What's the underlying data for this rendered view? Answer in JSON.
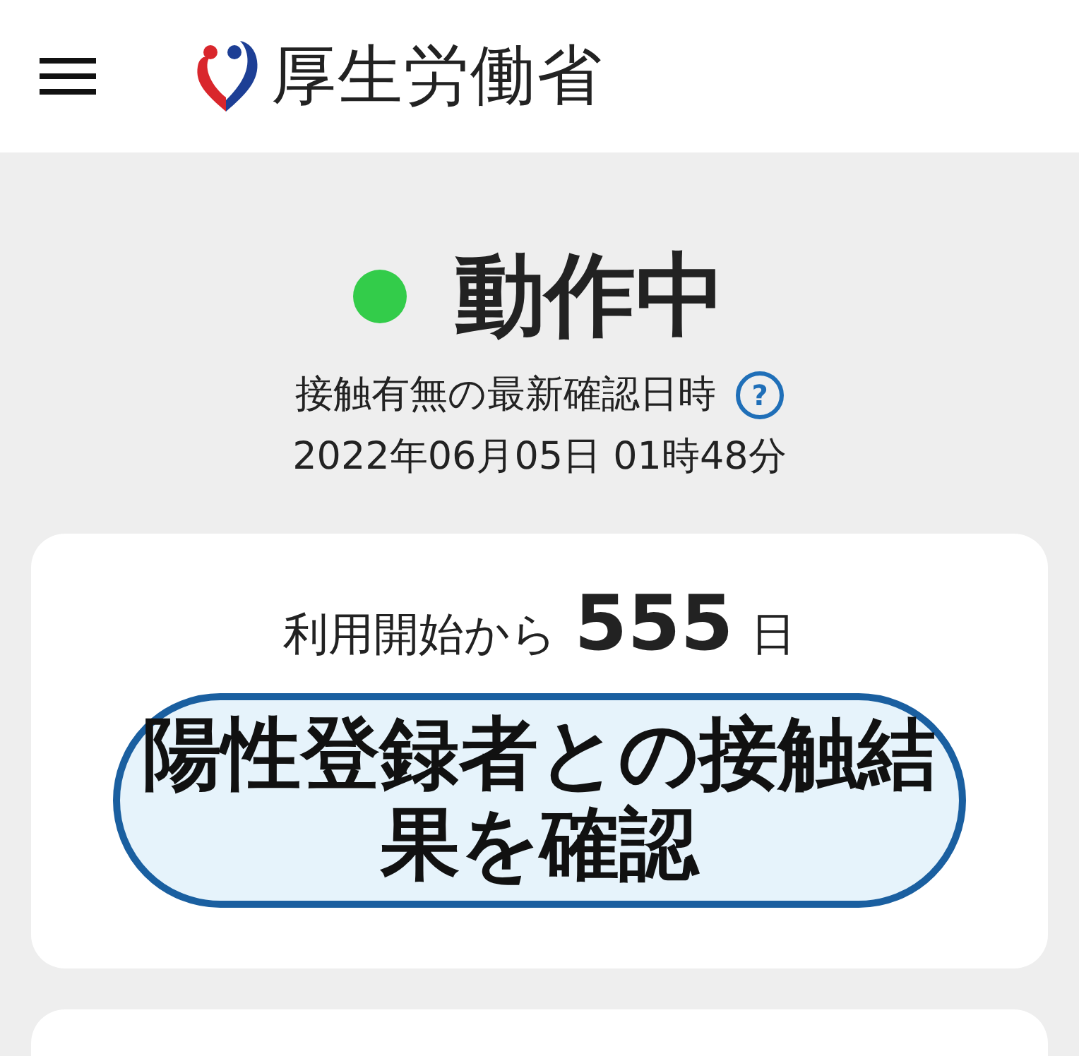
{
  "header": {
    "logo_text": "厚生労働省"
  },
  "status": {
    "text": "動作中",
    "on": true
  },
  "last_check": {
    "label": "接触有無の最新確認日時",
    "help": "?",
    "datetime": "2022年06月05日 01時48分"
  },
  "usage": {
    "prefix": "利用開始から",
    "days": "555",
    "suffix": "日"
  },
  "check_button": {
    "label": "陽性登録者との接触結果を確認"
  }
}
